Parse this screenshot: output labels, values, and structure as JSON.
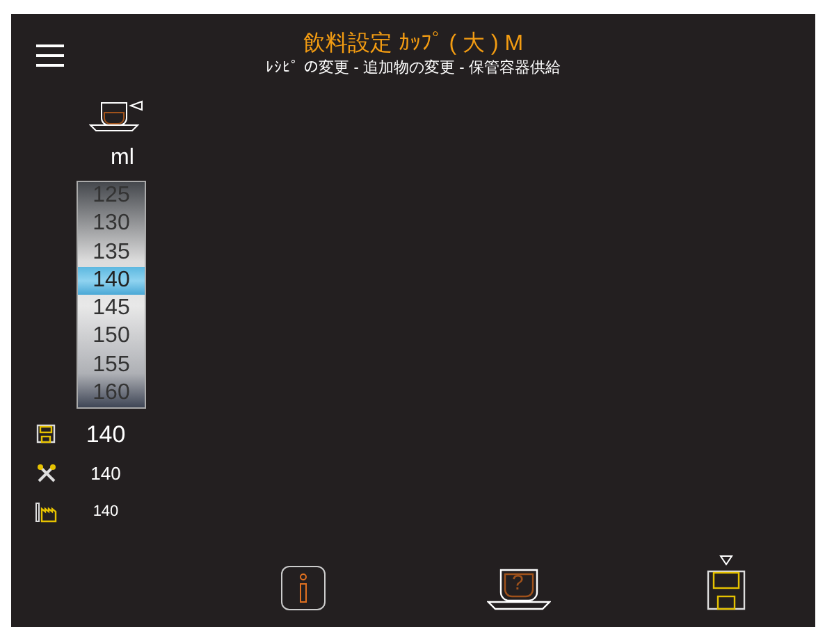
{
  "header": {
    "title": "飲料設定 ｶｯﾌﾟ ( 大 ) M",
    "subtitle": "ﾚｼﾋﾟ の変更 - 追加物の変更 - 保管容器供給"
  },
  "unit": "ml",
  "picker": [
    {
      "value": "125",
      "selected": false
    },
    {
      "value": "130",
      "selected": false
    },
    {
      "value": "135",
      "selected": false
    },
    {
      "value": "140",
      "selected": true
    },
    {
      "value": "145",
      "selected": false
    },
    {
      "value": "150",
      "selected": false
    },
    {
      "value": "155",
      "selected": false
    },
    {
      "value": "160",
      "selected": false
    }
  ],
  "values": [
    {
      "kind": "saved",
      "value": "140"
    },
    {
      "kind": "user",
      "value": "140"
    },
    {
      "kind": "factory",
      "value": "140"
    }
  ],
  "help_symbol": "?"
}
